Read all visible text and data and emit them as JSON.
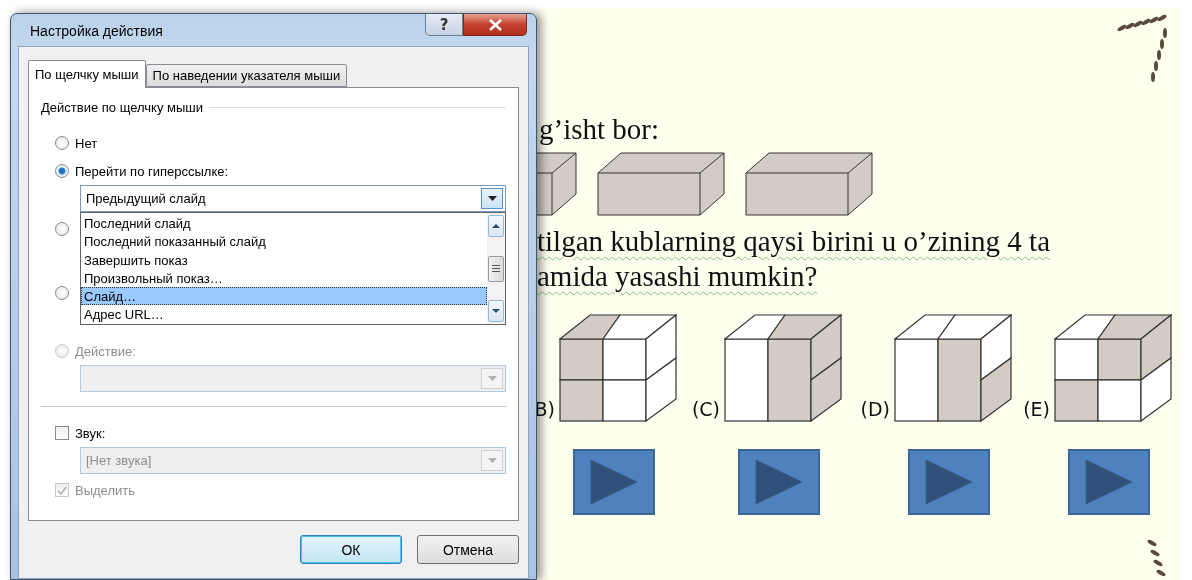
{
  "dialog": {
    "title": "Настройка действия",
    "help_button": "?",
    "tabs": [
      {
        "label": "По щелчку мыши",
        "selected": true
      },
      {
        "label": "По наведении указателя мыши",
        "selected": false
      }
    ],
    "group_label": "Действие по щелчку мыши",
    "radios_top": [
      {
        "label": "Нет",
        "selected": false
      },
      {
        "label": "Перейти по гиперссылке:",
        "selected": true
      }
    ],
    "hyperlink_combo": {
      "value": "Предыдущий слайд",
      "items": [
        {
          "label": "Последний слайд",
          "selected": false
        },
        {
          "label": "Последний показанный слайд",
          "selected": false
        },
        {
          "label": "Завершить показ",
          "selected": false
        },
        {
          "label": "Произвольный показ…",
          "selected": false
        },
        {
          "label": "Слайд…",
          "selected": true
        },
        {
          "label": "Адрес URL…",
          "selected": false
        }
      ]
    },
    "hidden_radios": [
      {
        "selected": false
      },
      {
        "selected": false
      }
    ],
    "action_radio": {
      "label": "Действие:",
      "selected": false,
      "disabled": true
    },
    "action_combo": {
      "disabled": true
    },
    "sound": {
      "label": "Звук:",
      "checked": false
    },
    "sound_combo": {
      "value": "[Нет звука]",
      "disabled": true
    },
    "highlight": {
      "label": "Выделить",
      "checked": true,
      "disabled": true
    },
    "buttons": [
      {
        "label": "ОК",
        "default": true
      },
      {
        "label": "Отмена",
        "default": false
      }
    ]
  },
  "slide": {
    "line_1": "g’isht bor:",
    "question_lines": [
      "tilgan kublarning qaysi birini u o’zining 4 ta",
      "amida yasashi mumkin?"
    ],
    "options": [
      {
        "label": "B)"
      },
      {
        "label": "(C)"
      },
      {
        "label": "(D)"
      },
      {
        "label": "(E)"
      }
    ]
  }
}
